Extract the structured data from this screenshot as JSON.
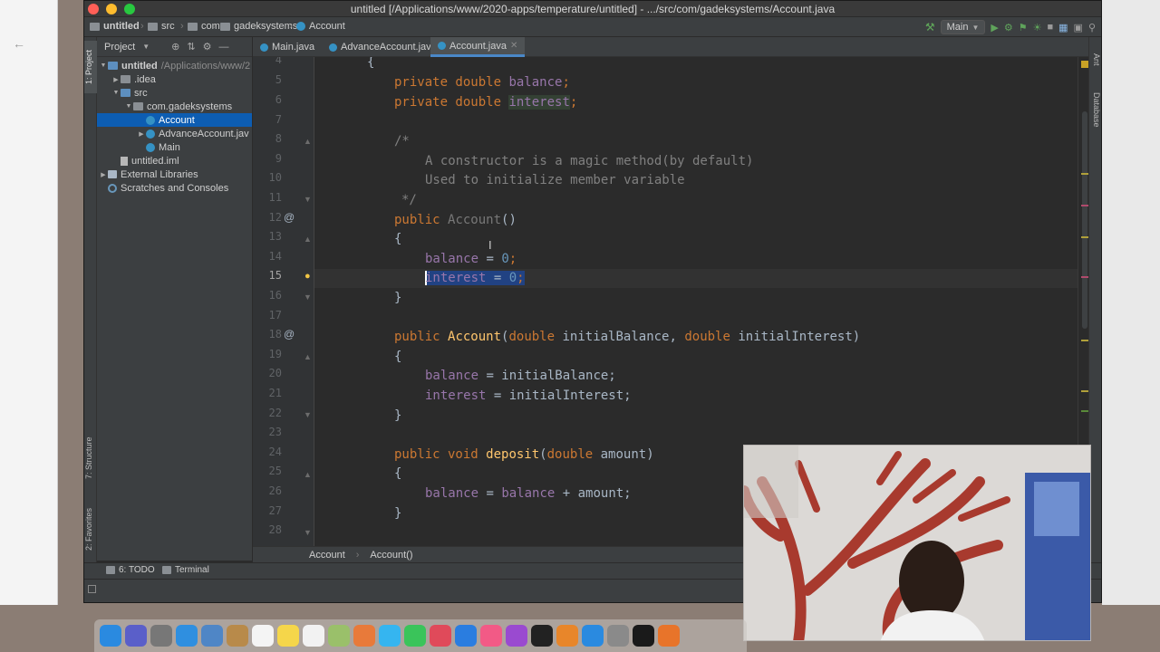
{
  "window": {
    "title": "untitled [/Applications/www/2020-apps/temperature/untitled] - .../src/com/gadeksystems/Account.java"
  },
  "navbar": {
    "crumbs": [
      "untitled",
      "src",
      "com",
      "gadeksystems",
      "Account"
    ],
    "run_config": "Main"
  },
  "tool_strip": {
    "left": [
      "1: Project",
      "7: Structure",
      "2: Favorites"
    ],
    "right": [
      "Ant",
      "Database"
    ]
  },
  "project_panel": {
    "title": "Project",
    "tree": [
      {
        "label": "untitled",
        "extra": "/Applications/www/2",
        "icon": "folder-icon",
        "expanded": true
      },
      {
        "label": ".idea",
        "icon": "folder-icon"
      },
      {
        "label": "src",
        "icon": "folder-icon",
        "expanded": true
      },
      {
        "label": "com.gadeksystems",
        "icon": "package-icon",
        "expanded": true
      },
      {
        "label": "Account",
        "icon": "class-icon",
        "selected": true
      },
      {
        "label": "AdvanceAccount.jav",
        "icon": "class-icon"
      },
      {
        "label": "Main",
        "icon": "class-icon"
      },
      {
        "label": "untitled.iml",
        "icon": "file-icon"
      },
      {
        "label": "External Libraries",
        "icon": "library-icon"
      },
      {
        "label": "Scratches and Consoles",
        "icon": "scratch-icon"
      }
    ]
  },
  "editor": {
    "tabs": [
      {
        "label": "Main.java"
      },
      {
        "label": "AdvanceAccount.java"
      },
      {
        "label": "Account.java",
        "active": true
      }
    ],
    "line_numbers": [
      "4",
      "5",
      "6",
      "7",
      "8",
      "9",
      "10",
      "11",
      "12",
      "13",
      "14",
      "15",
      "16",
      "17",
      "18",
      "19",
      "20",
      "21",
      "22",
      "23",
      "24",
      "25",
      "26",
      "27",
      "28"
    ],
    "current_line": "15",
    "breadcrumb": [
      "Account",
      "Account()"
    ]
  },
  "code": {
    "l4": "{",
    "l5_kw": "private double ",
    "l5_fld": "balance",
    "l5_end": ";",
    "l6_kw": "private double ",
    "l6_fld": "interest",
    "l6_end": ";",
    "l8": "/*",
    "l9": "A constructor is a magic method(by default)",
    "l10": "Used to initialize member variable",
    "l11": "*/",
    "l12_kw": "public ",
    "l12_name": "Account",
    "l12_end": "()",
    "l13": "{",
    "l14_fld": "balance",
    "l14_op": " = ",
    "l14_num": "0",
    "l14_end": ";",
    "l15_fld": "interest",
    "l15_op": " = ",
    "l15_num": "0",
    "l15_end": ";",
    "l16": "}",
    "l18_kw": "public ",
    "l18_name": "Account",
    "l18_p1": "(",
    "l18_t1": "double ",
    "l18_a1": "initialBalance, ",
    "l18_t2": "double ",
    "l18_a2": "initialInterest)",
    "l19": "{",
    "l20_fld": "balance",
    "l20_rest": " = initialBalance;",
    "l21_fld": "interest",
    "l21_rest": " = initialInterest;",
    "l22": "}",
    "l24_kw": "public void ",
    "l24_name": "deposit",
    "l24_p": "(",
    "l24_t": "double ",
    "l24_a": "amount)",
    "l25": "{",
    "l26_fld": "balance",
    "l26_op": " = ",
    "l26_fld2": "balance",
    "l26_rest": " + amount;",
    "l27": "}"
  },
  "bottom_bar": {
    "todo": "6: TODO",
    "terminal": "Terminal"
  },
  "colors": {
    "keyword": "#cc7832",
    "field": "#9876aa",
    "number": "#6897bb",
    "comment": "#808080",
    "method": "#ffc66d",
    "text": "#a9b7c6",
    "selection": "#214283",
    "editor_bg": "#2b2b2b"
  }
}
